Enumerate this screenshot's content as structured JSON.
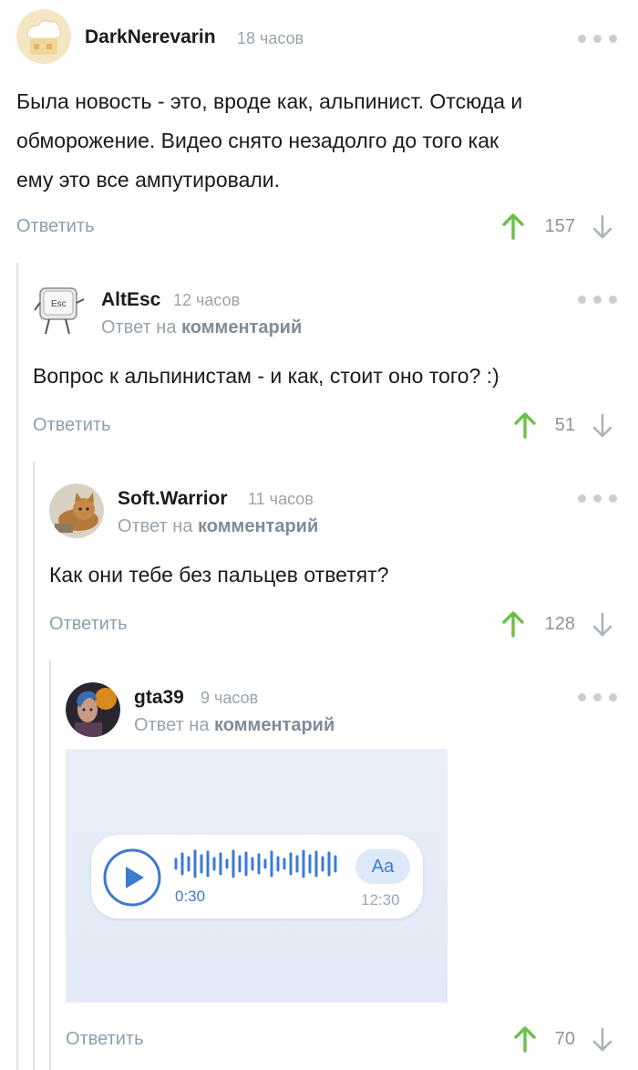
{
  "comments": [
    {
      "username": "DarkNerevarin",
      "time": "18 часов",
      "text_lines": [
        "Была новость - это, вроде как, альпинист. Отсюда и",
        "обморожение. Видео снято незадолго до того как",
        "ему это все ампутировали."
      ],
      "reply_label": "Ответить",
      "rating": "157"
    },
    {
      "username": "AltEsc",
      "time": "12 часов",
      "reply_to_prefix": "Ответ на",
      "reply_to_link": "комментарий",
      "text": "Вопрос к альпинистам - и как, стоит оно того? :)",
      "reply_label": "Ответить",
      "rating": "51",
      "avatar_key_label": "Esc"
    },
    {
      "username": "Soft.Warrior",
      "time": "11 часов",
      "reply_to_prefix": "Ответ на",
      "reply_to_link": "комментарий",
      "text": "Как они тебе без пальцев ответят?",
      "reply_label": "Ответить",
      "rating": "128"
    },
    {
      "username": "gta39",
      "time": "9 часов",
      "reply_to_prefix": "Ответ на",
      "reply_to_link": "комментарий",
      "voice_message": {
        "duration": "0:30",
        "timestamp": "12:30",
        "transcribe_label": "Aa"
      },
      "reply_label": "Ответить",
      "rating": "70"
    }
  ],
  "colors": {
    "upvote": "#6cc04a",
    "downvote": "#aab3ba",
    "link": "#8aa0ad",
    "thread_line": "#e1e4e7",
    "voice_accent": "#3b7bd0"
  }
}
